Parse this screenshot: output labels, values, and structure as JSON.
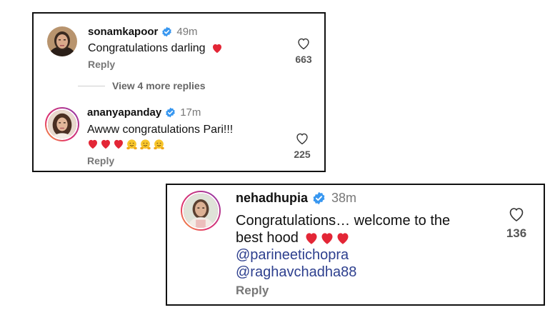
{
  "colors": {
    "verified_blue": "#3897f0",
    "heart_red": "#e32636",
    "mention_blue": "#2d3f8e",
    "muted_gray": "#777777"
  },
  "comments": [
    {
      "username": "sonamkapoor",
      "time": "49m",
      "text": "Congratulations darling",
      "emoji": [
        "heart"
      ],
      "reply_label": "Reply",
      "likes": "663",
      "like_icon": "heart-outline-icon"
    },
    {
      "view_more_label": "View 4 more replies"
    },
    {
      "username": "ananyapanday",
      "time": "17m",
      "text": "Awww congratulations Pari!!!",
      "emoji": [
        "heart",
        "heart",
        "heart",
        "hugging-face",
        "hugging-face",
        "hugging-face"
      ],
      "reply_label": "Reply",
      "likes": "225",
      "like_icon": "heart-outline-icon"
    },
    {
      "username": "nehadhupia",
      "time": "38m",
      "text_line1": "Congratulations… welcome to the",
      "text_line2": "best hood",
      "emoji": [
        "heart",
        "heart",
        "heart"
      ],
      "mentions": [
        "@parineetichopra",
        "@raghavchadha88"
      ],
      "reply_label": "Reply",
      "likes": "136",
      "like_icon": "heart-outline-icon"
    }
  ]
}
